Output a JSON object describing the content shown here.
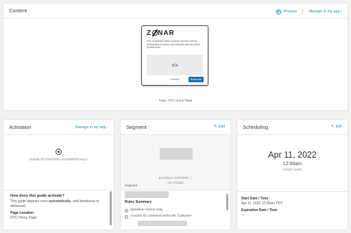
{
  "content": {
    "title": "Content",
    "preview_label": "Preview",
    "manage_label": "Manage in my app ›",
    "card": {
      "logo_prefix": "Z",
      "logo_suffix": "NAR",
      "text": "Help us develop better products and earn $25 by participating in a short user interview with the Zonar product team.",
      "code_glyph": "<>",
      "dismiss_label": "Dismiss",
      "book_label": "Book now"
    },
    "page_caption": "Page: OTC Home Page"
  },
  "activation": {
    "title": "Activation",
    "manage_label": "Manage in my app ›",
    "center_caption": "GUIDE ACTIVATION: AUTOMATICALLY",
    "question": "How does this guide activate?",
    "answer_pre": "This guide appears once ",
    "answer_bold": "automatically",
    "answer_post": ", until dismissed or advanced.",
    "page_location_label": "Page Location",
    "page_location_value": "OTC Home Page"
  },
  "segment": {
    "title": "Segment",
    "edit_label": "Edit",
    "eligible_caption": "ELIGIBLE VISITORS",
    "as_of_caption": "(as of today)",
    "segment_label": "Segment",
    "rules_title": "Rules Summary",
    "rules": [
      "Identified Visitors Only",
      "Account ID contained within list 'Customer"
    ]
  },
  "scheduling": {
    "title": "Scheduling",
    "edit_label": "Edit",
    "date": "Apr 11, 2022",
    "time": "12:00am",
    "start_caption": "START DATE",
    "start_label": "Start Date / Time",
    "start_value": "Apr 11, 2022 12:00am PDT",
    "expiration_label": "Expiration Date / Time",
    "expiration_value": "—"
  },
  "colors": {
    "accent": "#1f8da8",
    "button": "#1f6fa8"
  }
}
